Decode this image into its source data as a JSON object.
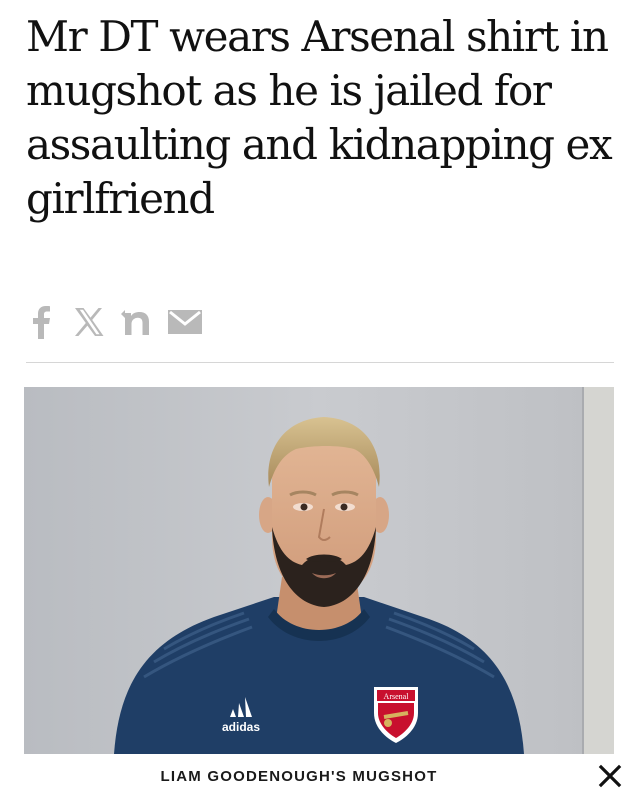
{
  "article": {
    "headline": "Mr DT wears Arsenal shirt in mugshot as he is jailed for assaulting and kidnapping ex girlfriend"
  },
  "share": {
    "icons": [
      "facebook-icon",
      "x-icon",
      "flipboard-icon",
      "email-icon"
    ],
    "icon_color": "#b9b9b9"
  },
  "photo": {
    "shirt_brand": "adidas",
    "badge_text": "Arsenal",
    "background_color": "#c3c5c9",
    "shirt_color": "#1f3e66"
  },
  "caption": {
    "text": "LIAM GOODENOUGH'S MUGSHOT"
  }
}
